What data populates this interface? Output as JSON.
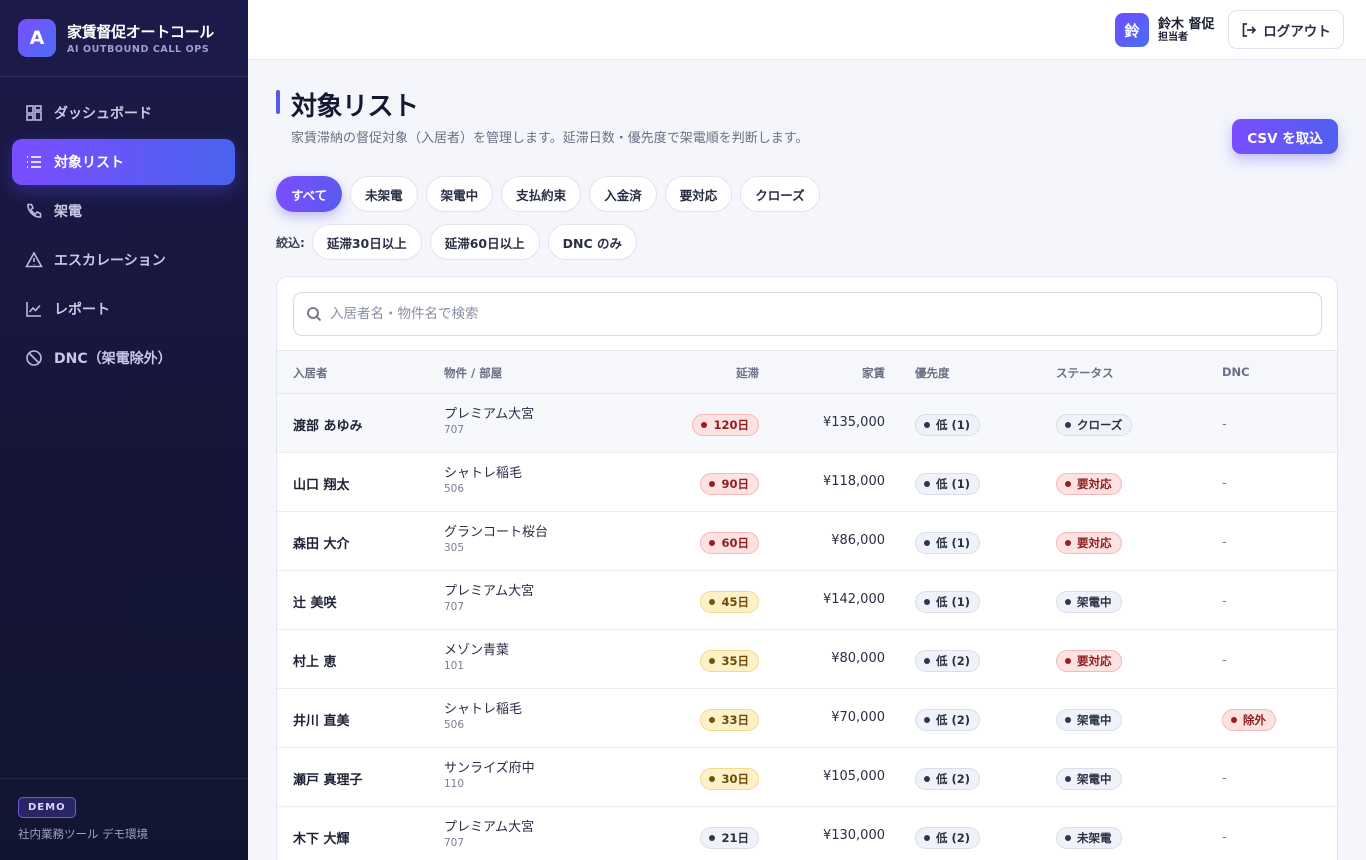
{
  "app": {
    "logo_letter": "A",
    "title": "家賃督促オートコール",
    "subtitle": "AI OUTBOUND CALL OPS"
  },
  "sidebar": {
    "items": [
      {
        "label": "ダッシュボード",
        "icon": "dashboard-icon"
      },
      {
        "label": "対象リスト",
        "icon": "list-icon",
        "active": true
      },
      {
        "label": "架電",
        "icon": "phone-icon"
      },
      {
        "label": "エスカレーション",
        "icon": "warning-icon"
      },
      {
        "label": "レポート",
        "icon": "chart-icon"
      },
      {
        "label": "DNC（架電除外）",
        "icon": "ban-icon"
      }
    ],
    "footer": {
      "badge": "DEMO",
      "text": "社内業務ツール デモ環境"
    }
  },
  "header": {
    "user": {
      "avatar": "鈴",
      "name": "鈴木 督促",
      "role": "担当者"
    },
    "logout_label": "ログアウト"
  },
  "main": {
    "title": "対象リスト",
    "description": "家賃滞納の督促対象（入居者）を管理します。延滞日数・優先度で架電順を判断します。",
    "csv_button": "CSV を取込",
    "tabs": [
      {
        "label": "すべて",
        "active": true
      },
      {
        "label": "未架電"
      },
      {
        "label": "架電中"
      },
      {
        "label": "支払約束"
      },
      {
        "label": "入金済"
      },
      {
        "label": "要対応"
      },
      {
        "label": "クローズ"
      }
    ],
    "filters_label": "絞込:",
    "filters": [
      "延滞30日以上",
      "延滞60日以上",
      "DNC のみ"
    ],
    "search_placeholder": "入居者名・物件名で検索",
    "table": {
      "headers": {
        "tenant": "入居者",
        "property": "物件 / 部屋",
        "delay": "延滞",
        "rent": "家賃",
        "priority": "優先度",
        "status": "ステータス",
        "dnc": "DNC"
      },
      "rows": [
        {
          "tenant": "渡部 あゆみ",
          "property": "プレミアム大宮",
          "room": "707",
          "delay": "120日",
          "delay_level": "red",
          "rent": "¥135,000",
          "priority": "低 (1)",
          "status": "クローズ",
          "status_level": "gray",
          "dnc": "-"
        },
        {
          "tenant": "山口 翔太",
          "property": "シャトレ稲毛",
          "room": "506",
          "delay": "90日",
          "delay_level": "red",
          "rent": "¥118,000",
          "priority": "低 (1)",
          "status": "要対応",
          "status_level": "red",
          "dnc": "-"
        },
        {
          "tenant": "森田 大介",
          "property": "グランコート桜台",
          "room": "305",
          "delay": "60日",
          "delay_level": "red",
          "rent": "¥86,000",
          "priority": "低 (1)",
          "status": "要対応",
          "status_level": "red",
          "dnc": "-"
        },
        {
          "tenant": "辻 美咲",
          "property": "プレミアム大宮",
          "room": "707",
          "delay": "45日",
          "delay_level": "yellow",
          "rent": "¥142,000",
          "priority": "低 (1)",
          "status": "架電中",
          "status_level": "gray",
          "dnc": "-"
        },
        {
          "tenant": "村上 恵",
          "property": "メゾン青葉",
          "room": "101",
          "delay": "35日",
          "delay_level": "yellow",
          "rent": "¥80,000",
          "priority": "低 (2)",
          "status": "要対応",
          "status_level": "red",
          "dnc": "-"
        },
        {
          "tenant": "井川 直美",
          "property": "シャトレ稲毛",
          "room": "506",
          "delay": "33日",
          "delay_level": "yellow",
          "rent": "¥70,000",
          "priority": "低 (2)",
          "status": "架電中",
          "status_level": "gray",
          "dnc": "除外"
        },
        {
          "tenant": "瀬戸 真理子",
          "property": "サンライズ府中",
          "room": "110",
          "delay": "30日",
          "delay_level": "yellow",
          "rent": "¥105,000",
          "priority": "低 (2)",
          "status": "架電中",
          "status_level": "gray",
          "dnc": "-"
        },
        {
          "tenant": "木下 大輝",
          "property": "プレミアム大宮",
          "room": "707",
          "delay": "21日",
          "delay_level": "gray",
          "rent": "¥130,000",
          "priority": "低 (2)",
          "status": "未架電",
          "status_level": "gray",
          "dnc": "-"
        }
      ]
    }
  }
}
